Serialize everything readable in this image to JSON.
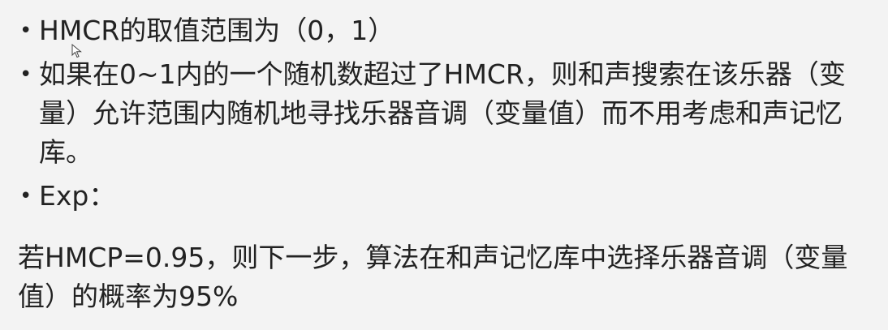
{
  "bullets": [
    {
      "text": "HMCR的取值范围为（0，1）"
    },
    {
      "text": "如果在0~1内的一个随机数超过了HMCR，则和声搜索在该乐器（变量）允许范围内随机地寻找乐器音调（变量值）而不用考虑和声记忆库。"
    },
    {
      "text": "Exp："
    }
  ],
  "bullet_symbol": "•",
  "example": {
    "text": "若HMCP=0.95，则下一步，算法在和声记忆库中选择乐器音调（变量值）的概率为95%"
  },
  "icons": {
    "cursor": "mouse-pointer-icon"
  }
}
